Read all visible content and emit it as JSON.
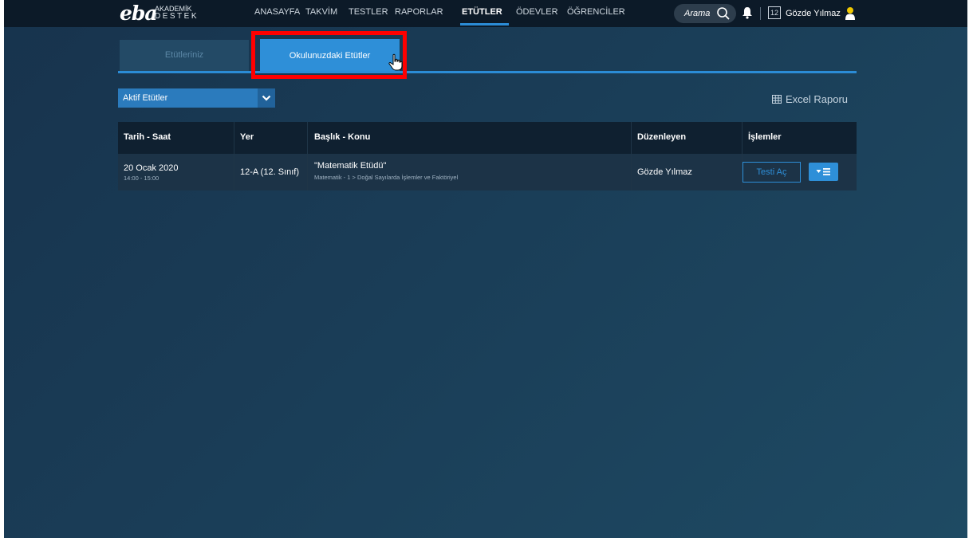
{
  "header": {
    "logo_main": "eba",
    "logo_sub_line1": "AKADEMİK",
    "logo_sub_line2": "DESTEK",
    "nav": [
      {
        "label": "ANASAYFA"
      },
      {
        "label": "TAKVİM"
      },
      {
        "label": "TESTLER"
      },
      {
        "label": "RAPORLAR"
      },
      {
        "label": "ETÜTLER",
        "active": true
      },
      {
        "label": "ÖDEVLER"
      },
      {
        "label": "ÖĞRENCİLER"
      }
    ],
    "search_placeholder": "Arama",
    "calendar_day": "12",
    "user_name": "Gözde Yılmaz"
  },
  "tabs": [
    {
      "label": "Etütleriniz",
      "selected": false
    },
    {
      "label": "Okulunuzdaki Etütler",
      "selected": true
    }
  ],
  "filter": {
    "selected": "Aktif Etütler"
  },
  "excel_report_label": "Excel Raporu",
  "table": {
    "headers": [
      "Tarih - Saat",
      "Yer",
      "Başlık - Konu",
      "Düzenleyen",
      "İşlemler"
    ],
    "rows": [
      {
        "date": "20 Ocak 2020",
        "time": "14:00 - 15:00",
        "place": "12-A (12. Sınıf)",
        "title": "\"Matematik Etüdü\"",
        "topic": "Matematik - 1 > Doğal Sayılarda İşlemler ve Faktöriyel",
        "organizer": "Gözde Yılmaz",
        "action_label": "Testi Aç"
      }
    ]
  },
  "colors": {
    "accent": "#2e8fd8",
    "highlight": "#ff0000",
    "topbar": "#0c1a28"
  }
}
